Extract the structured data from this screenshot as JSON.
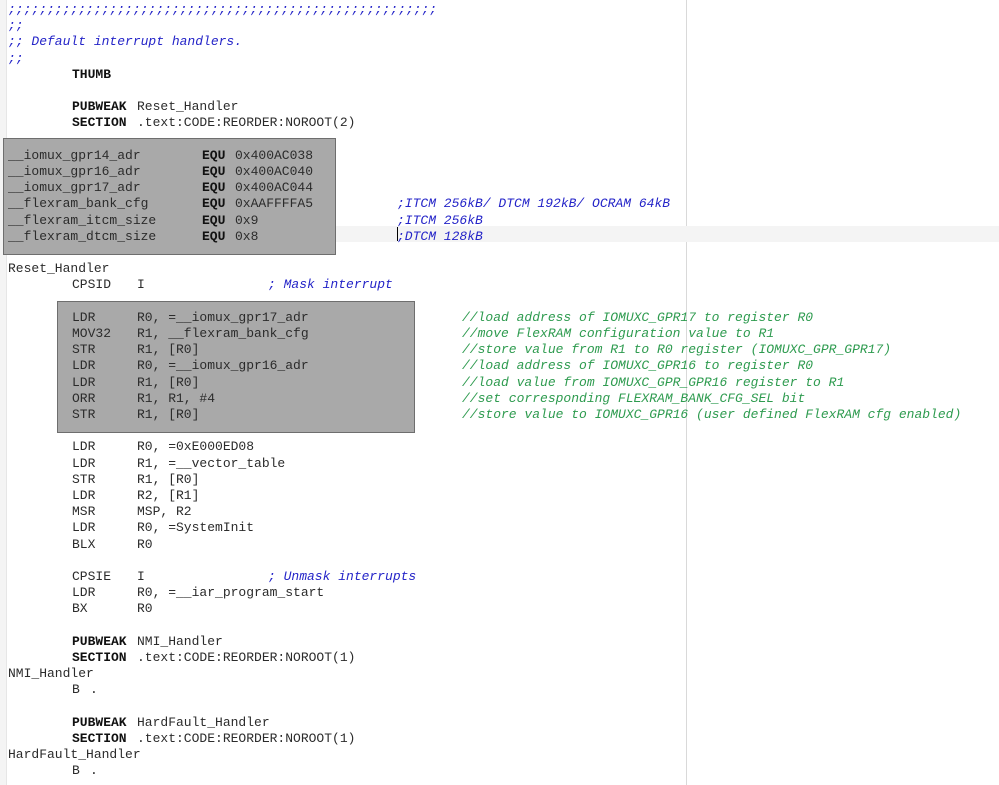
{
  "editor": {
    "colors": {
      "background": "#ffffff",
      "selection": "#a9a9a9",
      "keyword": "#111111",
      "comment_asm": "#2424c8",
      "comment_cpp": "#2e9b4f"
    },
    "lines": [
      {
        "t": [
          ";;;;;;;;;;;;;;;;;;;;;;;;;;;;;;;;;;;;;;;;;;;;;;;;;;;;;;;"
        ]
      },
      {
        "t": [
          ";;"
        ]
      },
      {
        "t": [
          ";; Default interrupt handlers."
        ]
      },
      {
        "t": [
          ";;"
        ]
      },
      {
        "t": [
          "THUMB"
        ]
      },
      {
        "t": []
      },
      {
        "t": [
          "PUBWEAK",
          "Reset_Handler"
        ]
      },
      {
        "t": [
          "SECTION",
          ".text:CODE:REORDER:NOROOT(2)"
        ]
      },
      {
        "t": []
      },
      {
        "t": [
          "__iomux_gpr14_adr",
          "EQU",
          "0x400AC038"
        ]
      },
      {
        "t": [
          "__iomux_gpr16_adr",
          "EQU",
          "0x400AC040"
        ]
      },
      {
        "t": [
          "__iomux_gpr17_adr",
          "EQU",
          "0x400AC044"
        ]
      },
      {
        "t": [
          "__flexram_bank_cfg",
          "EQU",
          "0xAAFFFFA5",
          ";ITCM 256kB/ DTCM 192kB/ OCRAM 64kB"
        ]
      },
      {
        "t": [
          "__flexram_itcm_size",
          "EQU",
          "0x9",
          ";ITCM 256kB"
        ]
      },
      {
        "t": [
          "__flexram_dtcm_size",
          "EQU",
          "0x8",
          ";DTCM 128kB"
        ]
      },
      {
        "t": []
      },
      {
        "t": [
          "Reset_Handler"
        ]
      },
      {
        "t": [
          "CPSID",
          "I",
          "; Mask interrupt"
        ]
      },
      {
        "t": []
      },
      {
        "t": [
          "LDR",
          "R0, =__iomux_gpr17_adr",
          "//load address of IOMUXC_GPR17 to register R0"
        ]
      },
      {
        "t": [
          "MOV32",
          "R1, __flexram_bank_cfg",
          "//move FlexRAM configuration value to R1"
        ]
      },
      {
        "t": [
          "STR",
          "R1, [R0]",
          "//store value from R1 to R0 register (IOMUXC_GPR_GPR17)"
        ]
      },
      {
        "t": [
          "LDR",
          "R0, =__iomux_gpr16_adr",
          "//load address of IOMUXC_GPR16 to register R0"
        ]
      },
      {
        "t": [
          "LDR",
          "R1, [R0]",
          "//load value from IOMUXC_GPR_GPR16 register to R1"
        ]
      },
      {
        "t": [
          "ORR",
          "R1, R1, #4",
          "//set corresponding FLEXRAM_BANK_CFG_SEL bit"
        ]
      },
      {
        "t": [
          "STR",
          "R1, [R0]",
          "//store value to IOMUXC_GPR16 (user defined FlexRAM cfg enabled)"
        ]
      },
      {
        "t": []
      },
      {
        "t": [
          "LDR",
          "R0, =0xE000ED08"
        ]
      },
      {
        "t": [
          "LDR",
          "R1, =__vector_table"
        ]
      },
      {
        "t": [
          "STR",
          "R1, [R0]"
        ]
      },
      {
        "t": [
          "LDR",
          "R2, [R1]"
        ]
      },
      {
        "t": [
          "MSR",
          "MSP, R2"
        ]
      },
      {
        "t": [
          "LDR",
          "R0, =SystemInit"
        ]
      },
      {
        "t": [
          "BLX",
          "R0"
        ]
      },
      {
        "t": []
      },
      {
        "t": [
          "CPSIE",
          "I",
          "; Unmask interrupts"
        ]
      },
      {
        "t": [
          "LDR",
          "R0, =__iar_program_start"
        ]
      },
      {
        "t": [
          "BX",
          "R0"
        ]
      },
      {
        "t": []
      },
      {
        "t": [
          "PUBWEAK",
          "NMI_Handler"
        ]
      },
      {
        "t": [
          "SECTION",
          ".text:CODE:REORDER:NOROOT(1)"
        ]
      },
      {
        "t": [
          "NMI_Handler"
        ]
      },
      {
        "t": [
          "B",
          "."
        ]
      },
      {
        "t": []
      },
      {
        "t": [
          "PUBWEAK",
          "HardFault_Handler"
        ]
      },
      {
        "t": [
          "SECTION",
          ".text:CODE:REORDER:NOROOT(1)"
        ]
      },
      {
        "t": [
          "HardFault_Handler"
        ]
      },
      {
        "t": [
          "B",
          "."
        ]
      }
    ]
  }
}
